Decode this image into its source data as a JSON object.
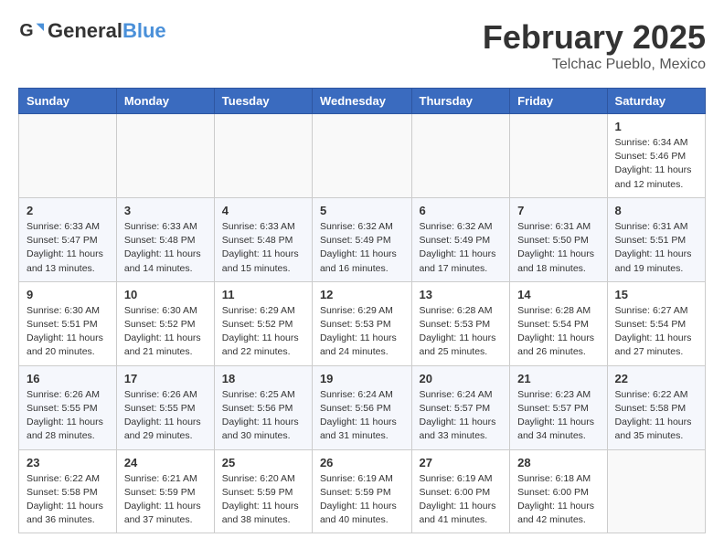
{
  "header": {
    "logo_general": "General",
    "logo_blue": "Blue",
    "month": "February 2025",
    "location": "Telchac Pueblo, Mexico"
  },
  "weekdays": [
    "Sunday",
    "Monday",
    "Tuesday",
    "Wednesday",
    "Thursday",
    "Friday",
    "Saturday"
  ],
  "weeks": [
    [
      {
        "day": "",
        "info": ""
      },
      {
        "day": "",
        "info": ""
      },
      {
        "day": "",
        "info": ""
      },
      {
        "day": "",
        "info": ""
      },
      {
        "day": "",
        "info": ""
      },
      {
        "day": "",
        "info": ""
      },
      {
        "day": "1",
        "info": "Sunrise: 6:34 AM\nSunset: 5:46 PM\nDaylight: 11 hours and 12 minutes."
      }
    ],
    [
      {
        "day": "2",
        "info": "Sunrise: 6:33 AM\nSunset: 5:47 PM\nDaylight: 11 hours and 13 minutes."
      },
      {
        "day": "3",
        "info": "Sunrise: 6:33 AM\nSunset: 5:48 PM\nDaylight: 11 hours and 14 minutes."
      },
      {
        "day": "4",
        "info": "Sunrise: 6:33 AM\nSunset: 5:48 PM\nDaylight: 11 hours and 15 minutes."
      },
      {
        "day": "5",
        "info": "Sunrise: 6:32 AM\nSunset: 5:49 PM\nDaylight: 11 hours and 16 minutes."
      },
      {
        "day": "6",
        "info": "Sunrise: 6:32 AM\nSunset: 5:49 PM\nDaylight: 11 hours and 17 minutes."
      },
      {
        "day": "7",
        "info": "Sunrise: 6:31 AM\nSunset: 5:50 PM\nDaylight: 11 hours and 18 minutes."
      },
      {
        "day": "8",
        "info": "Sunrise: 6:31 AM\nSunset: 5:51 PM\nDaylight: 11 hours and 19 minutes."
      }
    ],
    [
      {
        "day": "9",
        "info": "Sunrise: 6:30 AM\nSunset: 5:51 PM\nDaylight: 11 hours and 20 minutes."
      },
      {
        "day": "10",
        "info": "Sunrise: 6:30 AM\nSunset: 5:52 PM\nDaylight: 11 hours and 21 minutes."
      },
      {
        "day": "11",
        "info": "Sunrise: 6:29 AM\nSunset: 5:52 PM\nDaylight: 11 hours and 22 minutes."
      },
      {
        "day": "12",
        "info": "Sunrise: 6:29 AM\nSunset: 5:53 PM\nDaylight: 11 hours and 24 minutes."
      },
      {
        "day": "13",
        "info": "Sunrise: 6:28 AM\nSunset: 5:53 PM\nDaylight: 11 hours and 25 minutes."
      },
      {
        "day": "14",
        "info": "Sunrise: 6:28 AM\nSunset: 5:54 PM\nDaylight: 11 hours and 26 minutes."
      },
      {
        "day": "15",
        "info": "Sunrise: 6:27 AM\nSunset: 5:54 PM\nDaylight: 11 hours and 27 minutes."
      }
    ],
    [
      {
        "day": "16",
        "info": "Sunrise: 6:26 AM\nSunset: 5:55 PM\nDaylight: 11 hours and 28 minutes."
      },
      {
        "day": "17",
        "info": "Sunrise: 6:26 AM\nSunset: 5:55 PM\nDaylight: 11 hours and 29 minutes."
      },
      {
        "day": "18",
        "info": "Sunrise: 6:25 AM\nSunset: 5:56 PM\nDaylight: 11 hours and 30 minutes."
      },
      {
        "day": "19",
        "info": "Sunrise: 6:24 AM\nSunset: 5:56 PM\nDaylight: 11 hours and 31 minutes."
      },
      {
        "day": "20",
        "info": "Sunrise: 6:24 AM\nSunset: 5:57 PM\nDaylight: 11 hours and 33 minutes."
      },
      {
        "day": "21",
        "info": "Sunrise: 6:23 AM\nSunset: 5:57 PM\nDaylight: 11 hours and 34 minutes."
      },
      {
        "day": "22",
        "info": "Sunrise: 6:22 AM\nSunset: 5:58 PM\nDaylight: 11 hours and 35 minutes."
      }
    ],
    [
      {
        "day": "23",
        "info": "Sunrise: 6:22 AM\nSunset: 5:58 PM\nDaylight: 11 hours and 36 minutes."
      },
      {
        "day": "24",
        "info": "Sunrise: 6:21 AM\nSunset: 5:59 PM\nDaylight: 11 hours and 37 minutes."
      },
      {
        "day": "25",
        "info": "Sunrise: 6:20 AM\nSunset: 5:59 PM\nDaylight: 11 hours and 38 minutes."
      },
      {
        "day": "26",
        "info": "Sunrise: 6:19 AM\nSunset: 5:59 PM\nDaylight: 11 hours and 40 minutes."
      },
      {
        "day": "27",
        "info": "Sunrise: 6:19 AM\nSunset: 6:00 PM\nDaylight: 11 hours and 41 minutes."
      },
      {
        "day": "28",
        "info": "Sunrise: 6:18 AM\nSunset: 6:00 PM\nDaylight: 11 hours and 42 minutes."
      },
      {
        "day": "",
        "info": ""
      }
    ]
  ]
}
